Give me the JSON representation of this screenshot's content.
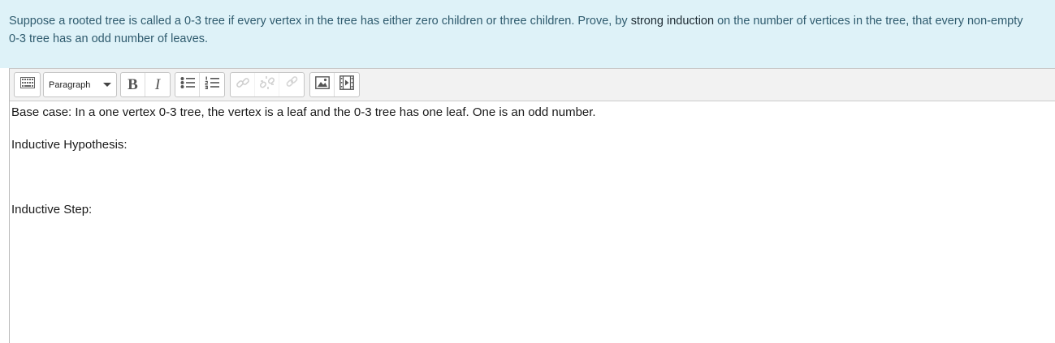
{
  "question": {
    "text_before": "Suppose a rooted tree is called a 0-3 tree if every vertex in the tree has either zero children or three children. Prove, by",
    "text_strong": "strong induction",
    "text_after": "on the number of vertices in the tree, that every non-empty 0-3 tree has an odd number of leaves."
  },
  "toolbar": {
    "toggle_icon": "toolbar-toggle-icon",
    "paragraph_select": "Paragraph",
    "bold_label": "B",
    "italic_label": "I",
    "icons": [
      "bullet-list-icon",
      "numbered-list-icon",
      "link-icon",
      "unlink-icon",
      "anchor-icon",
      "image-icon",
      "media-icon"
    ]
  },
  "editor": {
    "base_case": "Base case: In a one vertex 0-3 tree, the vertex is a leaf and the 0-3 tree has one leaf. One is an odd number.",
    "inductive_hypothesis": "Inductive Hypothesis:",
    "inductive_step": "Inductive Step:"
  }
}
